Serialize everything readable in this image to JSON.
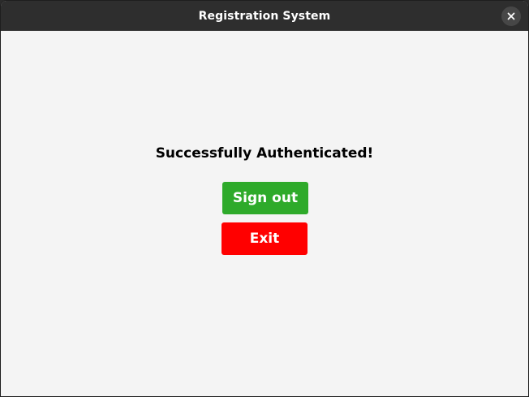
{
  "window": {
    "title": "Registration System",
    "close_icon": "close-icon"
  },
  "main": {
    "message": "Successfully Authenticated!",
    "sign_out_label": "Sign out",
    "exit_label": "Exit"
  },
  "colors": {
    "titlebar": "#2e2e2e",
    "background": "#f4f4f4",
    "sign_out_button": "#2eaa2a",
    "exit_button": "#ff0000"
  }
}
